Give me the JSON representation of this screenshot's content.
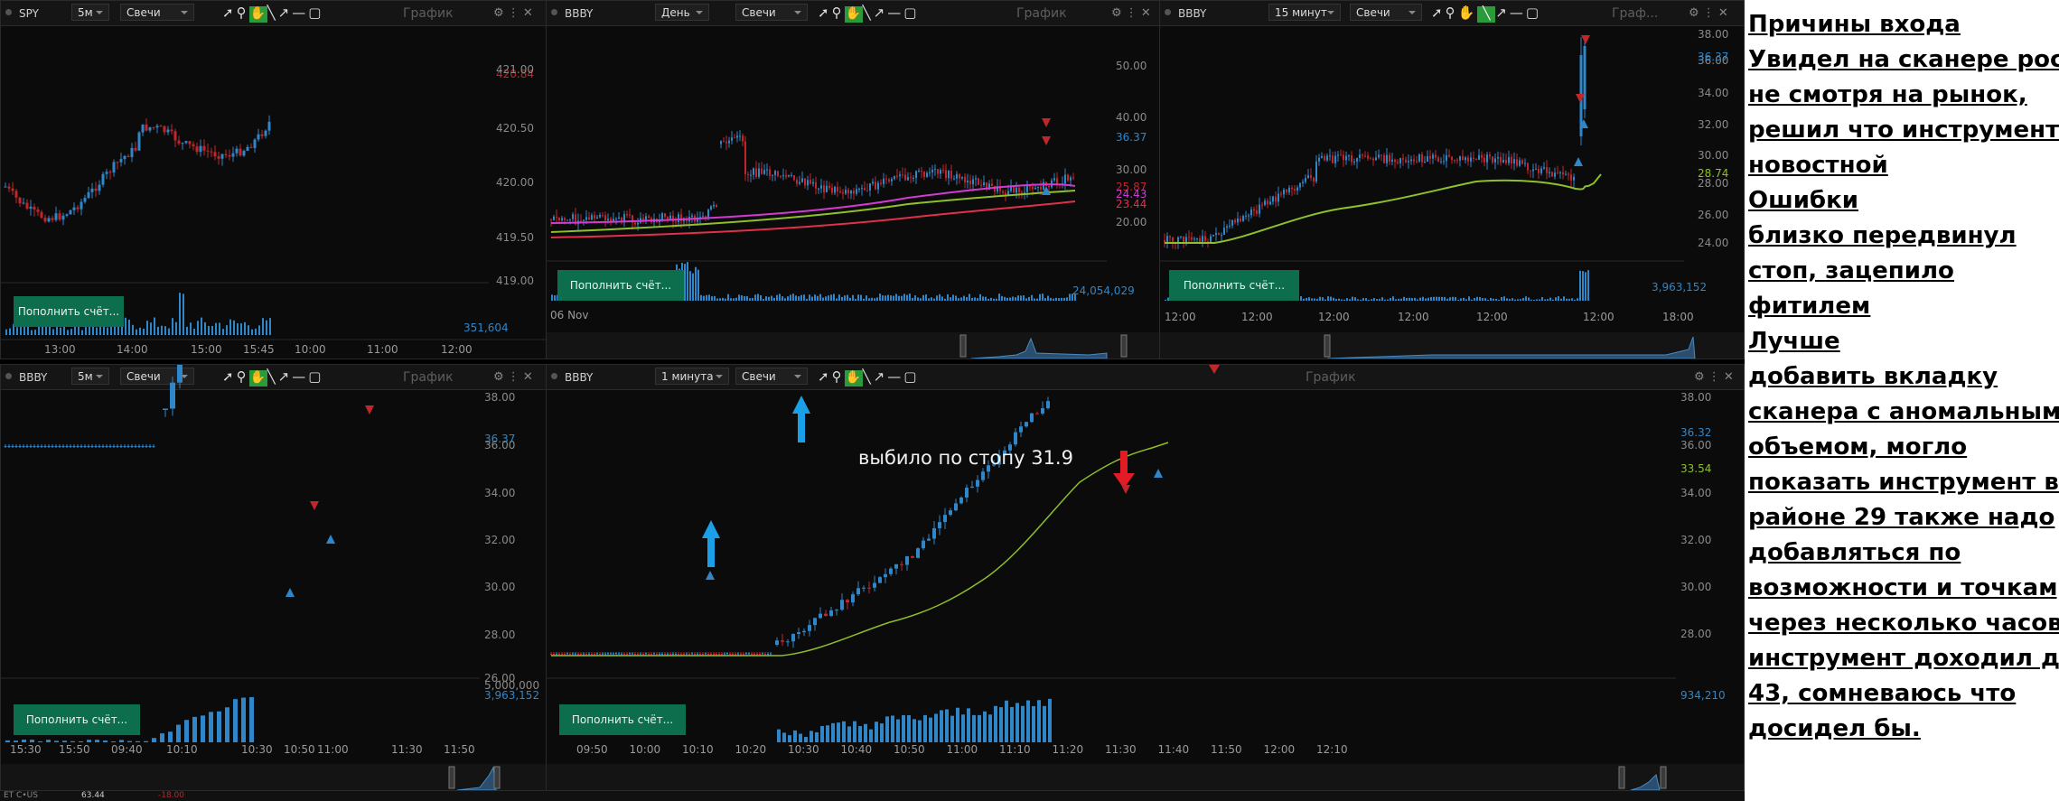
{
  "panels": {
    "spy": {
      "symbol": "SPY",
      "interval": "5м",
      "type": "Свечи",
      "title": "График",
      "fund": "Пополнить счёт...",
      "prices": [
        "421.00",
        "420.50",
        "420.00",
        "419.50",
        "419.00"
      ],
      "last_tags": [
        "421.00",
        "420.84"
      ],
      "volume_label": "351,604",
      "times": [
        "13:00",
        "14:00",
        "15:00",
        "15:45",
        "10:00",
        "11:00",
        "12:00"
      ]
    },
    "bbby_day": {
      "symbol": "BBBY",
      "interval": "День",
      "type": "Свечи",
      "title": "График",
      "fund": "Пополнить счёт...",
      "prices": [
        "50.00",
        "40.00",
        "30.00",
        "20.00"
      ],
      "tags": [
        "36.37",
        "25.87",
        "24.43",
        "23.44"
      ],
      "volume_label": "24,054,029",
      "date_label": "06 Nov"
    },
    "bbby_15": {
      "symbol": "BBBY",
      "interval": "15 минут",
      "type": "Свечи",
      "title": "Граф...",
      "fund": "Пополнить счёт...",
      "prices": [
        "38.00",
        "36.00",
        "34.00",
        "32.00",
        "30.00",
        "28.00",
        "26.00",
        "24.00"
      ],
      "tags": [
        "36.37",
        "28.74"
      ],
      "volume_label": "3,963,152",
      "times": [
        "12:00",
        "12:00",
        "12:00",
        "12:00",
        "12:00",
        "12:00",
        "18:00"
      ]
    },
    "bbby_5": {
      "symbol": "BBBY",
      "interval": "5м",
      "type": "Свечи",
      "title": "График",
      "fund": "Пополнить счёт...",
      "prices": [
        "38.00",
        "36.00",
        "34.00",
        "32.00",
        "30.00",
        "28.00",
        "26.00"
      ],
      "tags": [
        "36.37"
      ],
      "volume_labels": [
        "5,000,000",
        "3,963,152"
      ],
      "times": [
        "15:30",
        "15:50",
        "09:40",
        "10:10",
        "10:30",
        "10:50",
        "11:00",
        "11:30",
        "11:50"
      ]
    },
    "bbby_1": {
      "symbol": "BBBY",
      "interval": "1 минута",
      "type": "Свечи",
      "title": "График",
      "fund": "Пополнить счёт...",
      "prices": [
        "38.00",
        "36.00",
        "34.00",
        "32.00",
        "30.00",
        "28.00"
      ],
      "tags": [
        "36.32",
        "33.54"
      ],
      "volume_label": "934,210",
      "annotation": "выбило по стопу 31.9",
      "times": [
        "09:50",
        "10:00",
        "10:10",
        "10:20",
        "10:30",
        "10:40",
        "10:50",
        "11:00",
        "11:10",
        "11:20",
        "11:30",
        "11:40",
        "11:50",
        "12:00",
        "12:10"
      ]
    }
  },
  "status": {
    "left": "ET C•US",
    "value": "63.44",
    "change": "-18.00"
  },
  "notes": [
    "Причины входа",
    "Увидел на сканере рост,",
    "не смотря на рынок,",
    "решил что инструмент",
    "новостной",
    "Ошибки",
    "близко передвинул",
    "стоп, зацепило",
    "фитилем",
    "Лучше",
    "добавить вкладку",
    "сканера с аномальным",
    "объемом, могло",
    "показать инструмент в",
    "районе 29 также надо",
    "добавляться по",
    "возможности и точкам,",
    "через несколько часов",
    "инструмент доходил до",
    "43, сомневаюсь что",
    "досидел бы."
  ],
  "colors": {
    "up": "#2f86c8",
    "down": "#c0262b",
    "ma_green": "#8fbf2a",
    "ma_magenta": "#d23ad2",
    "ma_red": "#e0304a",
    "fund": "#0d6e4e"
  }
}
